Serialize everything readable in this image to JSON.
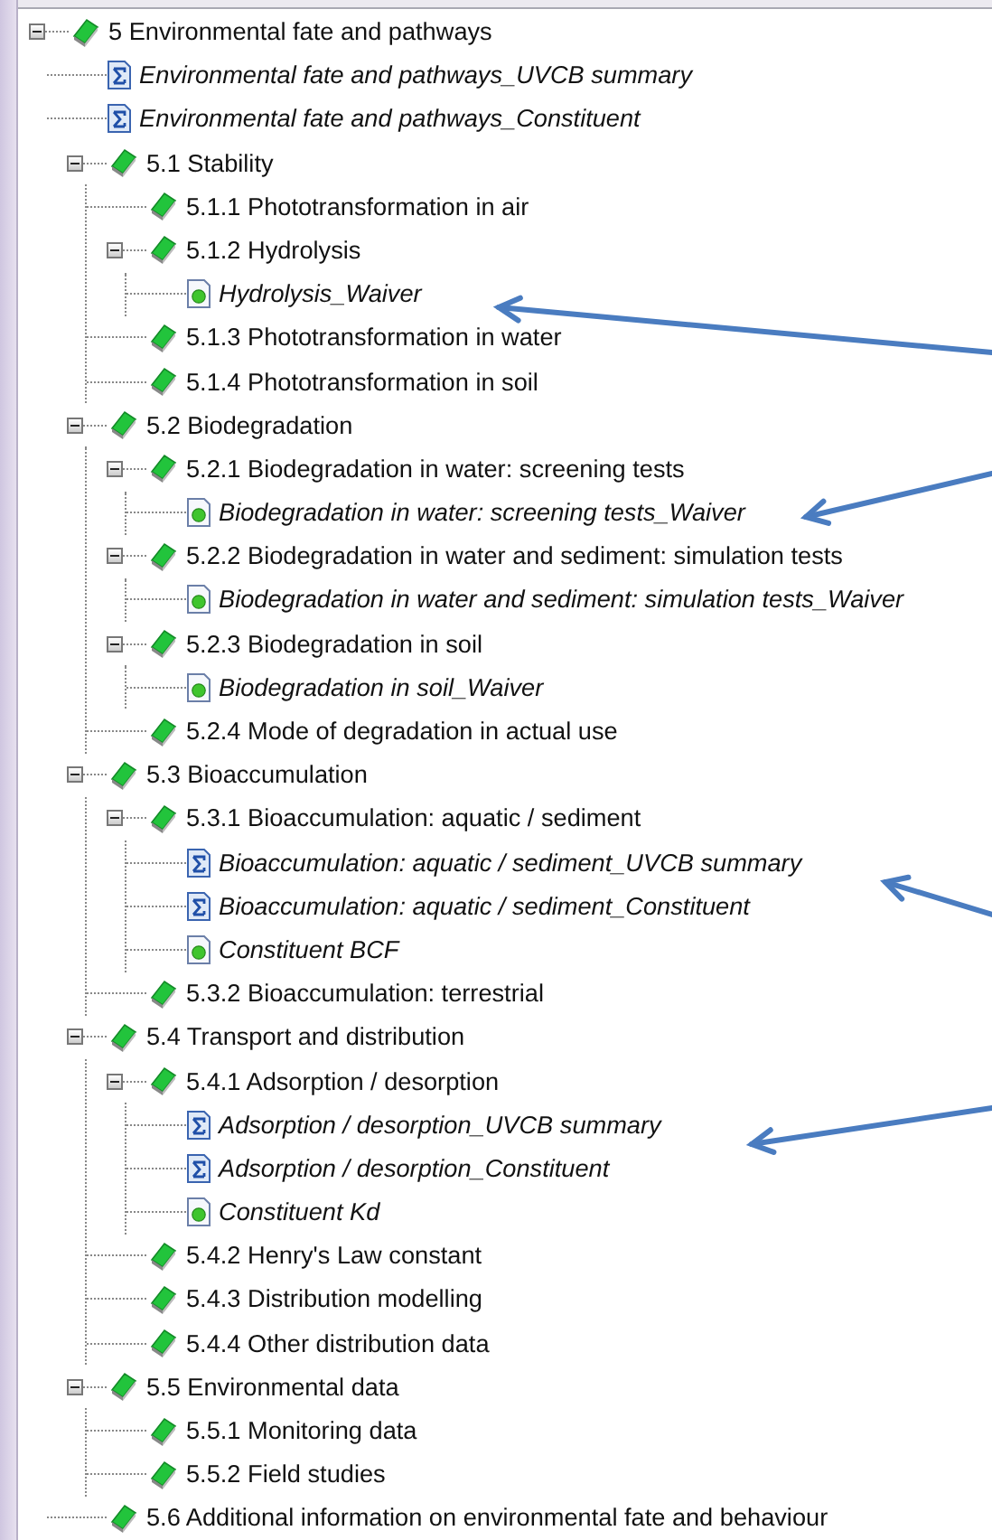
{
  "tree": [
    {
      "label": "5 Environmental fate and pathways",
      "kind": "section",
      "expanded": true,
      "children": [
        {
          "label": "Environmental fate and pathways_UVCB summary",
          "kind": "summary"
        },
        {
          "label": "Environmental fate and pathways_Constituent",
          "kind": "summary"
        },
        {
          "label": "5.1 Stability",
          "kind": "section",
          "expanded": true,
          "children": [
            {
              "label": "5.1.1 Phototransformation in air",
              "kind": "section"
            },
            {
              "label": "5.1.2 Hydrolysis",
              "kind": "section",
              "expanded": true,
              "children": [
                {
                  "label": "Hydrolysis_Waiver",
                  "kind": "record"
                }
              ]
            },
            {
              "label": "5.1.3 Phototransformation in water",
              "kind": "section"
            },
            {
              "label": "5.1.4 Phototransformation in soil",
              "kind": "section"
            }
          ]
        },
        {
          "label": "5.2 Biodegradation",
          "kind": "section",
          "expanded": true,
          "children": [
            {
              "label": "5.2.1 Biodegradation in water: screening tests",
              "kind": "section",
              "expanded": true,
              "children": [
                {
                  "label": "Biodegradation in water: screening tests_Waiver",
                  "kind": "record"
                }
              ]
            },
            {
              "label": "5.2.2 Biodegradation in water and sediment: simulation tests",
              "kind": "section",
              "expanded": true,
              "children": [
                {
                  "label": "Biodegradation in water and sediment: simulation tests_Waiver",
                  "kind": "record"
                }
              ]
            },
            {
              "label": "5.2.3 Biodegradation in soil",
              "kind": "section",
              "expanded": true,
              "children": [
                {
                  "label": "Biodegradation in soil_Waiver",
                  "kind": "record"
                }
              ]
            },
            {
              "label": "5.2.4 Mode of degradation in actual use",
              "kind": "section"
            }
          ]
        },
        {
          "label": "5.3 Bioaccumulation",
          "kind": "section",
          "expanded": true,
          "children": [
            {
              "label": "5.3.1 Bioaccumulation: aquatic / sediment",
              "kind": "section",
              "expanded": true,
              "children": [
                {
                  "label": "Bioaccumulation: aquatic / sediment_UVCB summary",
                  "kind": "summary"
                },
                {
                  "label": "Bioaccumulation: aquatic / sediment_Constituent",
                  "kind": "summary"
                },
                {
                  "label": "Constituent BCF",
                  "kind": "record"
                }
              ]
            },
            {
              "label": "5.3.2 Bioaccumulation: terrestrial",
              "kind": "section"
            }
          ]
        },
        {
          "label": "5.4 Transport and distribution",
          "kind": "section",
          "expanded": true,
          "children": [
            {
              "label": "5.4.1 Adsorption / desorption",
              "kind": "section",
              "expanded": true,
              "children": [
                {
                  "label": "Adsorption / desorption_UVCB summary",
                  "kind": "summary"
                },
                {
                  "label": "Adsorption / desorption_Constituent",
                  "kind": "summary"
                },
                {
                  "label": "Constituent Kd",
                  "kind": "record"
                }
              ]
            },
            {
              "label": "5.4.2 Henry's Law constant",
              "kind": "section"
            },
            {
              "label": "5.4.3 Distribution modelling",
              "kind": "section"
            },
            {
              "label": "5.4.4 Other distribution data",
              "kind": "section"
            }
          ]
        },
        {
          "label": "5.5 Environmental data",
          "kind": "section",
          "expanded": true,
          "children": [
            {
              "label": "5.5.1 Monitoring data",
              "kind": "section"
            },
            {
              "label": "5.5.2 Field studies",
              "kind": "section"
            }
          ]
        },
        {
          "label": "5.6 Additional information on environmental fate and behaviour",
          "kind": "section"
        }
      ]
    }
  ]
}
